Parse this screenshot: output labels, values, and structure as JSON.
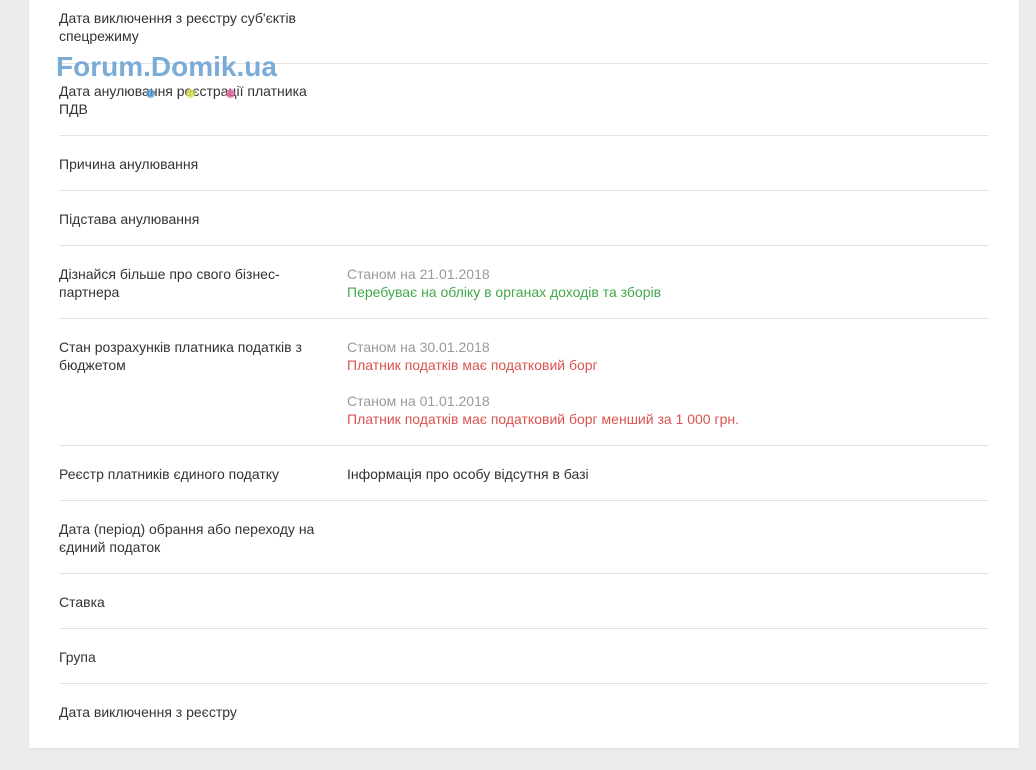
{
  "watermark": "Forum.Domik.ua",
  "rows": [
    {
      "label": "Дата виключення з реєстру суб'єктів спецрежиму"
    },
    {
      "label": "Дата анулювання реєстрації платника ПДВ"
    },
    {
      "label": "Причина анулювання"
    },
    {
      "label": "Підстава анулювання"
    },
    {
      "label": "Дізнайся більше про свого бізнес-партнера",
      "date": "Станом на 21.01.2018",
      "status": "Перебуває на обліку в органах доходів та зборів"
    },
    {
      "label": "Стан розрахунків платника податків з бюджетом",
      "date1": "Станом на 30.01.2018",
      "status1": "Платник податків має податковий борг",
      "date2": "Станом на 01.01.2018",
      "status2": "Платник податків має податковий борг менший за 1 000 грн."
    },
    {
      "label": "Реєстр платників єдиного податку",
      "value": "Інформація про особу відсутня в базі"
    },
    {
      "label": "Дата (період) обрання або переходу на єдиний податок"
    },
    {
      "label": "Ставка"
    },
    {
      "label": "Група"
    },
    {
      "label": "Дата виключення з реєстру"
    }
  ],
  "colors": {
    "status_ok": "#43a84b",
    "status_debt": "#d9534f",
    "date": "#9a9a9a",
    "watermark": "#6fa6d4"
  }
}
